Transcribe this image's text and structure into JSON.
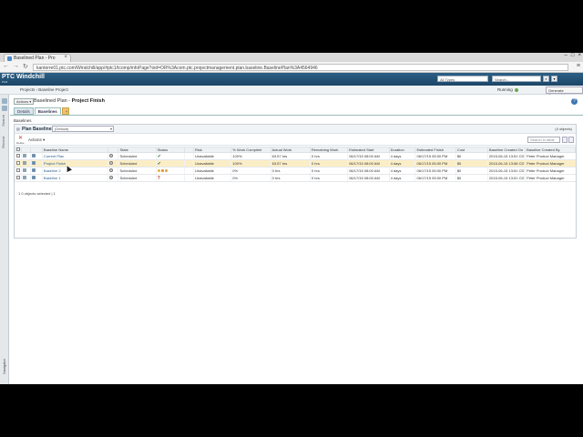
{
  "browser": {
    "tab_title": "Baselined Plan - Pro",
    "address": "kanterre01.ptc.com/Windchill/app/#ptc1/tcomp/infoPage?oid=OR%3Acom.ptc.projectmanagement.plan.baseline.BaselinePlan%3A4564946",
    "window_controls": [
      "–",
      "□",
      "×"
    ]
  },
  "header": {
    "brand": "PTC Windchill",
    "brand_sub": "PLM",
    "type_select": "All Types",
    "search_placeholder": "Search..."
  },
  "utility": {
    "breadcrumb": "Projects › Baseline Project",
    "status": "Running",
    "pw_button": "Generate Javascript..."
  },
  "navigator": {
    "labels": [
      "Search",
      "Recent"
    ],
    "footer": "Navigator"
  },
  "page": {
    "actions_button": "Actions ▾",
    "title_prefix": "Baselined Plan - ",
    "title_main": "Project Finish",
    "help": "?",
    "tabs": [
      "Details",
      "Baselines",
      "+"
    ],
    "section_label": "Baselines"
  },
  "panel": {
    "title": "Plan Baselines",
    "view_select": "(Default)",
    "count": "(4 objects)",
    "delete_label": "Delete",
    "actions_label": "Actions ▾",
    "search_placeholder": "Search in table",
    "columns": [
      "",
      "",
      "",
      "Baseline Name",
      "",
      "State",
      "Status",
      "",
      "Risk",
      "% Work Complete",
      "Actual Work",
      "Remaining Work",
      "Estimated Start",
      "Duration",
      "Estimated Finish",
      "Cost",
      "Baseline Created On",
      "Baseline Created By"
    ],
    "rows": [
      {
        "name": "Current Plan",
        "state": "Scheduled",
        "status": "check",
        "risk": "Unavailable",
        "pct": "100%",
        "actual": "63.57 hrs",
        "remaining": "0 hrs",
        "start": "06/17/15 08:00 AM",
        "duration": "4 days",
        "finish": "06/17/15 05:00 PM",
        "cost": "$0",
        "created_on": "2015-06-15 13:51 CDT",
        "created_by": "Peter Product Manager",
        "selected": false
      },
      {
        "name": "Project Finish",
        "state": "Scheduled",
        "status": "check",
        "risk": "Unavailable",
        "pct": "100%",
        "actual": "63.57 hrs",
        "remaining": "0 hrs",
        "start": "06/17/15 08:00 AM",
        "duration": "4 days",
        "finish": "06/17/15 05:00 PM",
        "cost": "$0",
        "created_on": "2015-06-15 13:58 CDT",
        "created_by": "Peter Product Manager",
        "selected": true
      },
      {
        "name": "Baseline 2",
        "state": "Scheduled",
        "status": "dots",
        "risk": "Unavailable",
        "pct": "0%",
        "actual": "0 hrs",
        "remaining": "0 hrs",
        "start": "06/17/15 08:00 AM",
        "duration": "4 days",
        "finish": "06/17/15 05:00 PM",
        "cost": "$0",
        "created_on": "2015-06-15 13:51 CDT",
        "created_by": "Peter Product Manager",
        "selected": false
      },
      {
        "name": "Baseline 1",
        "state": "Scheduled",
        "status": "question",
        "risk": "Unavailable",
        "pct": "0%",
        "actual": "0 hrs",
        "remaining": "0 hrs",
        "start": "06/17/15 08:00 AM",
        "duration": "4 days",
        "finish": "06/17/15 05:00 PM",
        "cost": "$0",
        "created_on": "2015-06-15 13:51 CDT",
        "created_by": "Peter Product Manager",
        "selected": false
      }
    ],
    "footer": "1 0 objects selected | 1"
  },
  "colors": {
    "header_bg": "#1c4566",
    "selected_row": "#fbeec7",
    "link": "#2b5e8e",
    "status_green": "#6aa84f",
    "warn_red": "#c0392b"
  }
}
